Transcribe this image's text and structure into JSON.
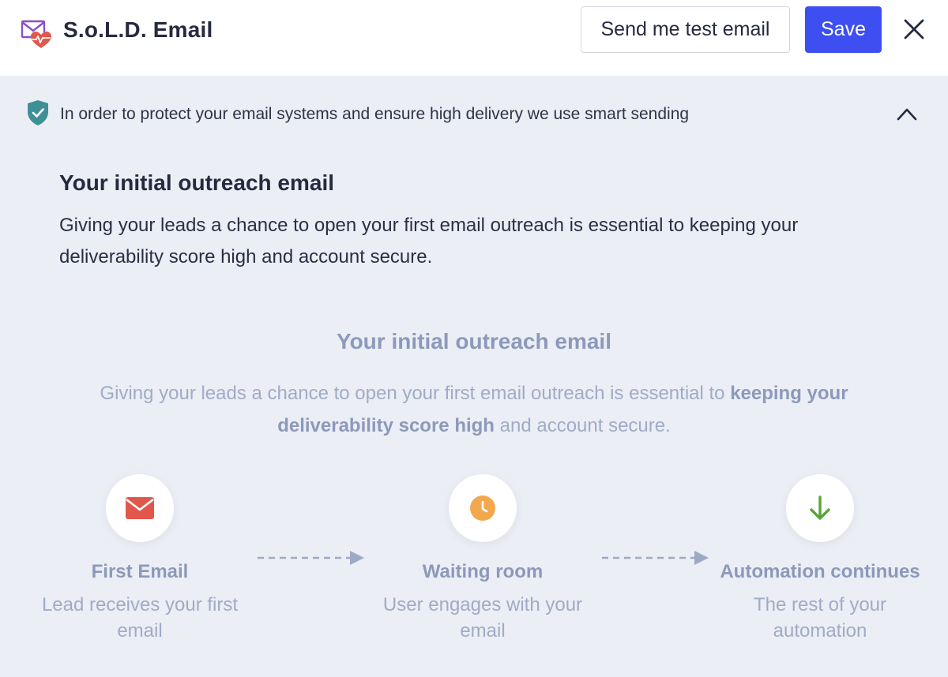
{
  "header": {
    "title": "S.o.L.D. Email",
    "test_email_label": "Send me test email",
    "save_label": "Save"
  },
  "notice": {
    "text": "In order to protect your email systems and ensure high delivery we use smart sending"
  },
  "section": {
    "title": "Your initial outreach email",
    "description": "Giving your leads a chance to open your first email outreach is essential to keeping your deliverability score high and account secure."
  },
  "illustration": {
    "title": "Your initial outreach email",
    "desc_before": "Giving your leads a chance to open your first email outreach is essential to ",
    "desc_bold": "keeping your deliverability score high",
    "desc_after": " and account secure.",
    "steps": [
      {
        "name": "First Email",
        "description": "Lead receives your first email",
        "icon": "envelope-icon",
        "color": "#e2574c"
      },
      {
        "name": "Waiting room",
        "description": "User engages with your email",
        "icon": "clock-icon",
        "color": "#f3a84e"
      },
      {
        "name": "Automation continues",
        "description": "The rest of your automation",
        "icon": "arrow-down-icon",
        "color": "#56a63a"
      }
    ]
  },
  "colors": {
    "accent": "#3d4ff0",
    "shield": "#3f8f97",
    "muted_text": "#a0abc6"
  }
}
